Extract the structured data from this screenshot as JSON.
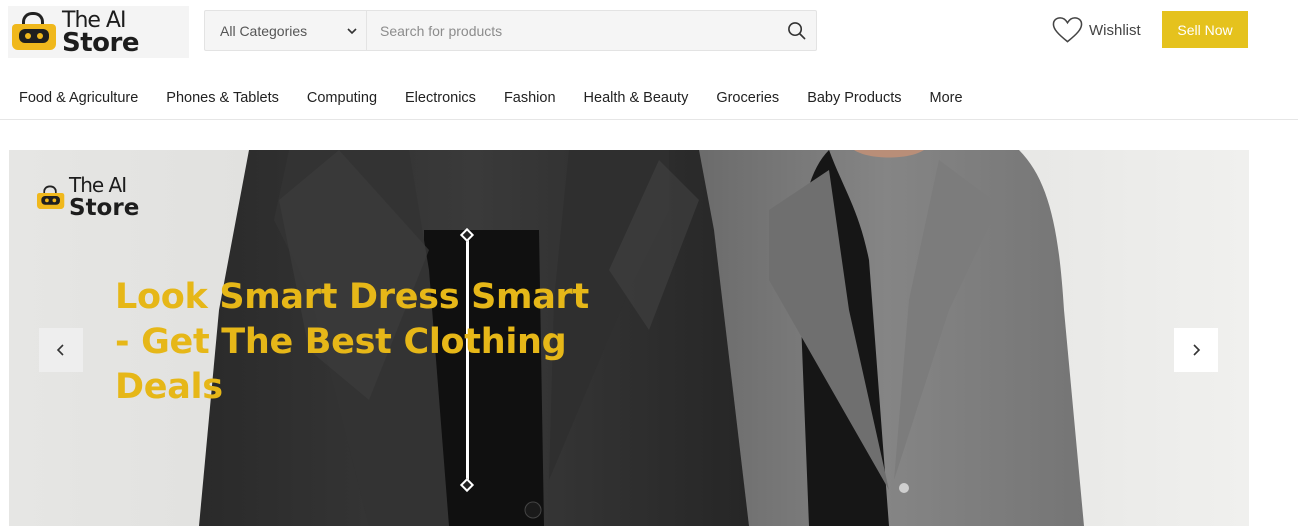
{
  "header": {
    "logo": {
      "line1": "The AI",
      "line2": "Store"
    },
    "search": {
      "category_selected": "All Categories",
      "placeholder": "Search for products"
    },
    "wishlist_label": "Wishlist",
    "sell_button": "Sell Now"
  },
  "nav": {
    "items": [
      {
        "label": "Food & Agriculture"
      },
      {
        "label": "Phones & Tablets"
      },
      {
        "label": "Computing"
      },
      {
        "label": "Electronics"
      },
      {
        "label": "Fashion"
      },
      {
        "label": "Health & Beauty"
      },
      {
        "label": "Groceries"
      },
      {
        "label": "Baby Products"
      },
      {
        "label": "More"
      }
    ]
  },
  "hero": {
    "logo": {
      "line1": "The AI",
      "line2": "Store"
    },
    "title": "Look Smart Dress Smart - Get The Best Clothing Deals"
  },
  "colors": {
    "accent": "#e5c21d",
    "headline": "#e6b718",
    "logo_bag": "#f0b81c"
  }
}
